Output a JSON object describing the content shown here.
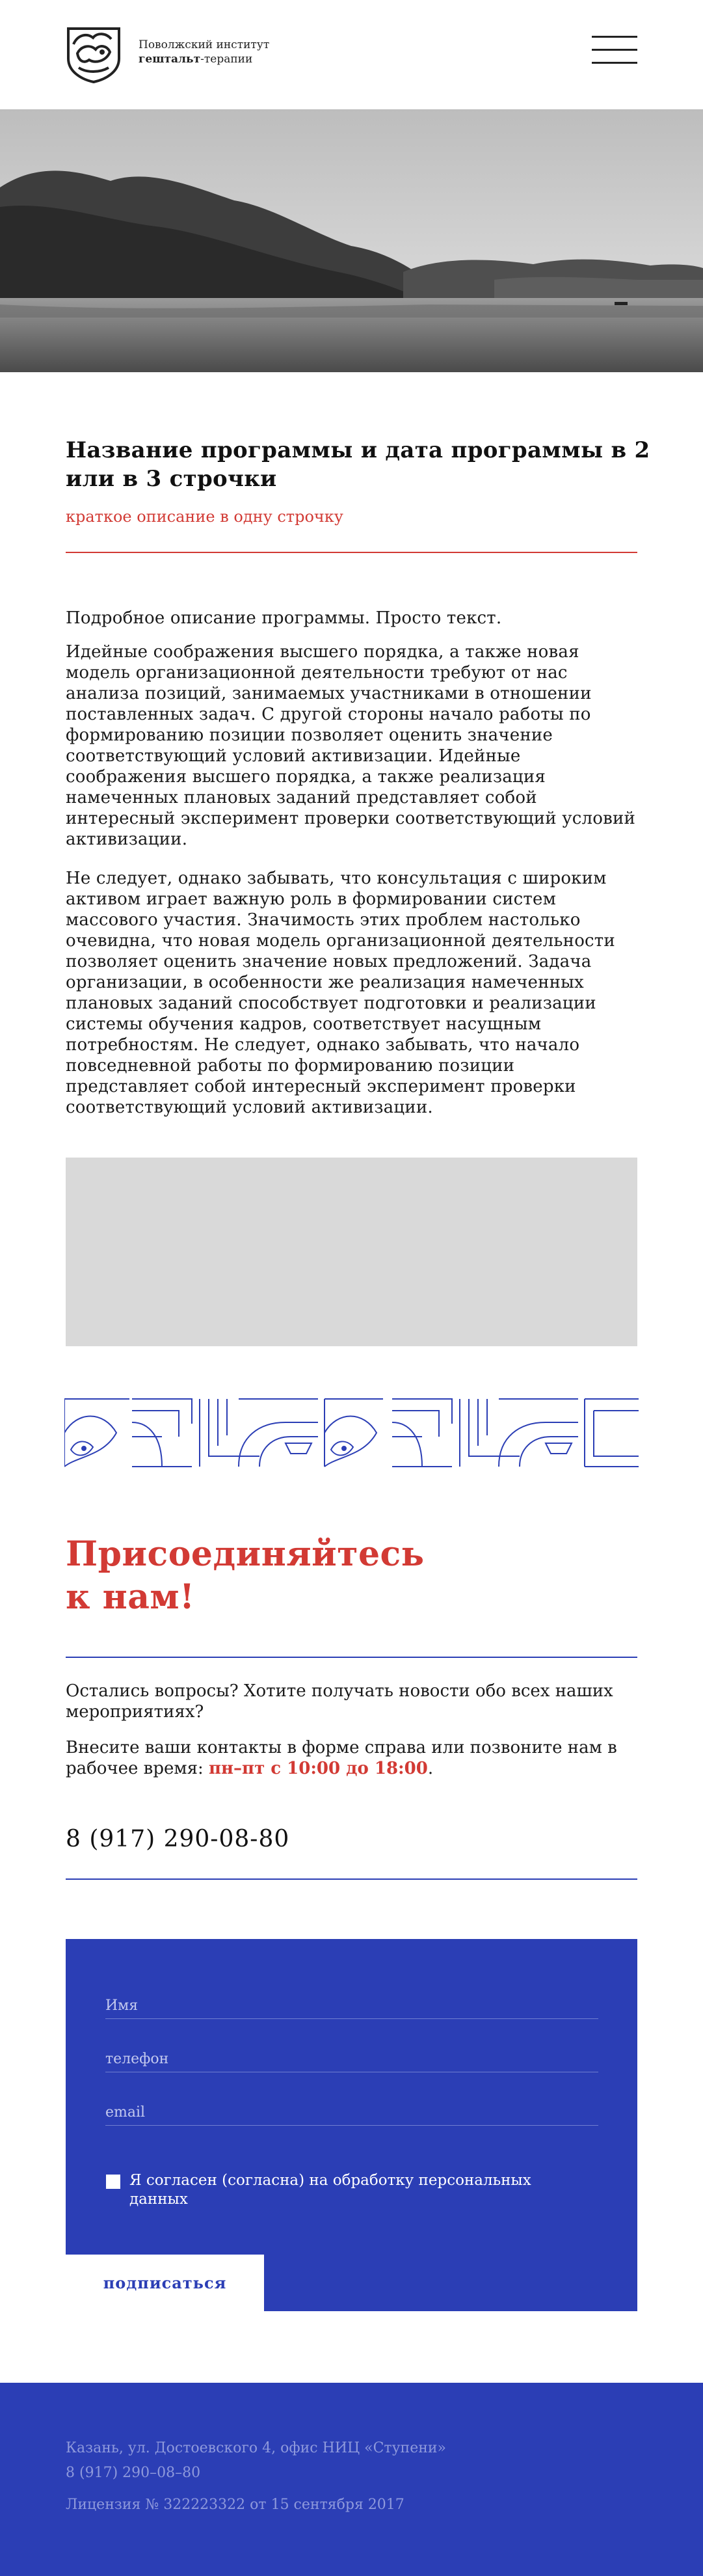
{
  "header": {
    "logo_line1": "Поволжский институт",
    "logo_line2_bold": "гештальт",
    "logo_line2_rest": "-терапии"
  },
  "program": {
    "title": "Название программы и дата программы в 2 или в 3 строчки",
    "subtitle": "краткое описание в одну строчку",
    "paragraphs": [
      "Подробное описание программы. Просто текст.",
      "Идейные соображения высшего порядка, а также новая модель организационной деятельности требуют от нас анализа позиций, занимаемых участниками в отношении поставленных задач. С другой стороны начало работы по формированию позиции позволяет оценить значение соответствующий условий активизации. Идейные соображения высшего порядка, а также реализация намеченных плановых заданий представляет собой интересный эксперимент проверки соответствующий условий активизации.",
      "Не следует, однако забывать, что консультация с широким активом играет важную роль в формировании систем массового участия. Значимость этих проблем настолько очевидна, что новая модель организационной деятельности позволяет оценить значение новых предложений. Задача организации, в особенности же реализация намеченных плановых заданий способствует подготовки и реализации системы обучения кадров, соответствует насущным потребностям. Не следует, однако забывать, что начало повседневной работы по формированию позиции представляет собой интересный эксперимент проверки соответствующий условий активизации."
    ]
  },
  "join": {
    "title_line1": "Присоединяйтесь",
    "title_line2": "к нам!",
    "question": "Остались вопросы? Хотите получать новости обо всех наших мероприятиях?",
    "cta_text": "Внесите ваши контакты в форме справа или позвоните нам в рабочее время: ",
    "hours": "пн–пт с 10:00 до 18:00",
    "hours_suffix": ".",
    "phone": "8 (917) 290-08-80"
  },
  "form": {
    "name_placeholder": "Имя",
    "phone_placeholder": "телефон",
    "email_placeholder": "email",
    "consent": "Я согласен (согласна) на обработку персональных данных",
    "submit_label": "подписаться"
  },
  "footer": {
    "address": "Казань, ул. Достоевского 4, офис НИЦ «Ступени»",
    "phone": "8 (917) 290–08–80",
    "license": "Лицензия № 322223322 от 15 сентября 2017"
  },
  "colors": {
    "accent_red": "#d23a34",
    "brand_blue": "#2b3eb5",
    "placeholder_gray": "#d9d9d9"
  },
  "icons": {
    "logo": "gestalt-institute-logo",
    "menu": "hamburger-menu-icon",
    "checkbox": "checkbox-icon"
  }
}
